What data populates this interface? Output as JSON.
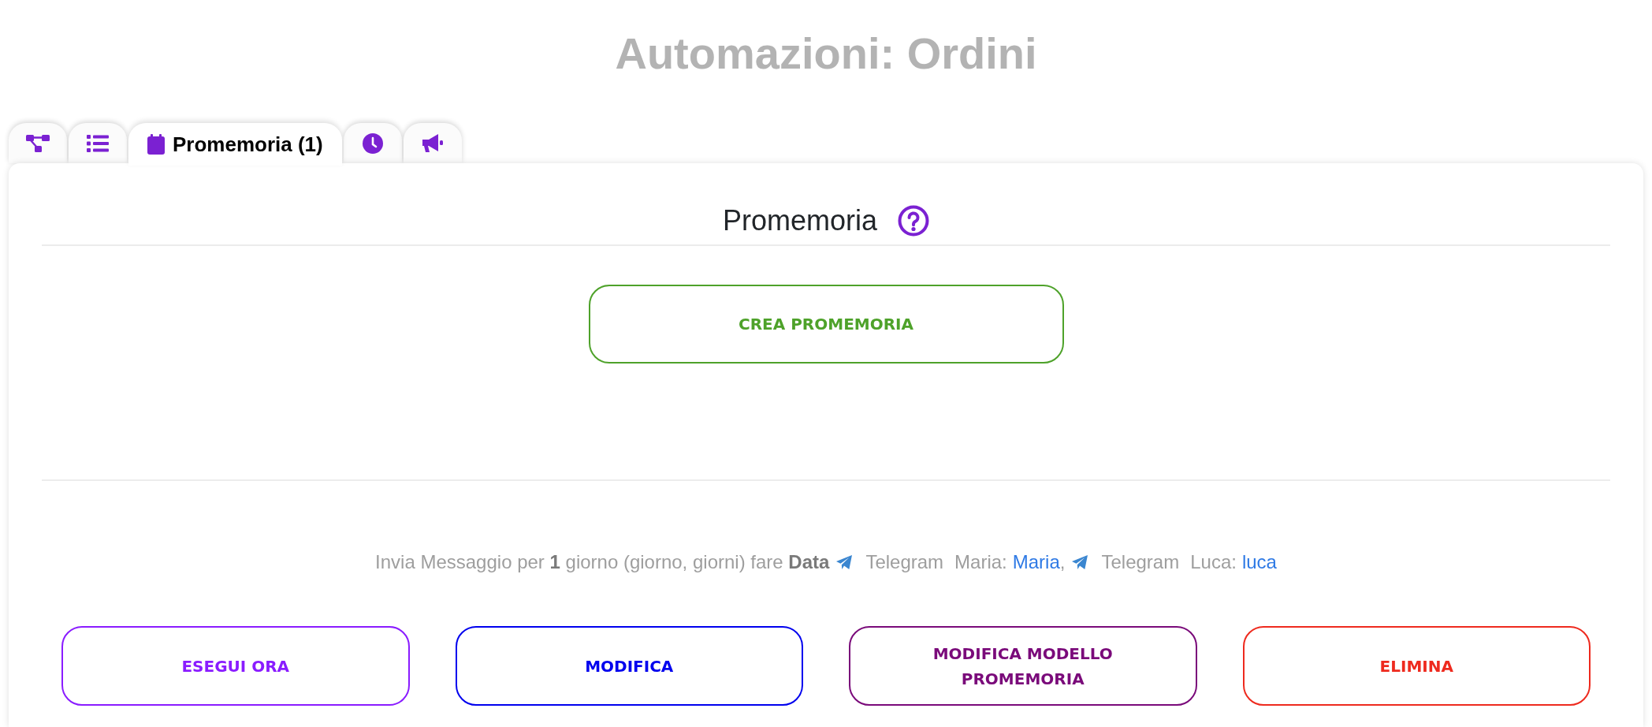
{
  "page": {
    "title": "Automazioni: Ordini"
  },
  "tabs": [
    {
      "selected": false
    },
    {
      "selected": false
    },
    {
      "label": "Promemoria (1)",
      "selected": true
    },
    {
      "selected": false
    },
    {
      "selected": false
    }
  ],
  "panel": {
    "title": "Promemoria",
    "create_button": "CREA PROMEMORIA",
    "summary": {
      "text": "Invia Messaggio per **1** giorno (giorno, giorni) fare **Data**",
      "recipients": [
        {
          "channel": "Telegram",
          "label": "Maria:",
          "link": "Maria",
          "suffix": ","
        },
        {
          "channel": "Telegram",
          "label": "Luca:",
          "link": "luca"
        }
      ]
    },
    "actions": [
      {
        "label": "ESEGUI ORA",
        "color": "#8a1cff"
      },
      {
        "label": "MODIFICA",
        "color": "#0000ee"
      },
      {
        "label": "MODIFICA MODELLO PROMEMORIA",
        "color": "#7a0a7a"
      },
      {
        "label": "ELIMINA",
        "color": "#ee2a1e"
      }
    ]
  }
}
